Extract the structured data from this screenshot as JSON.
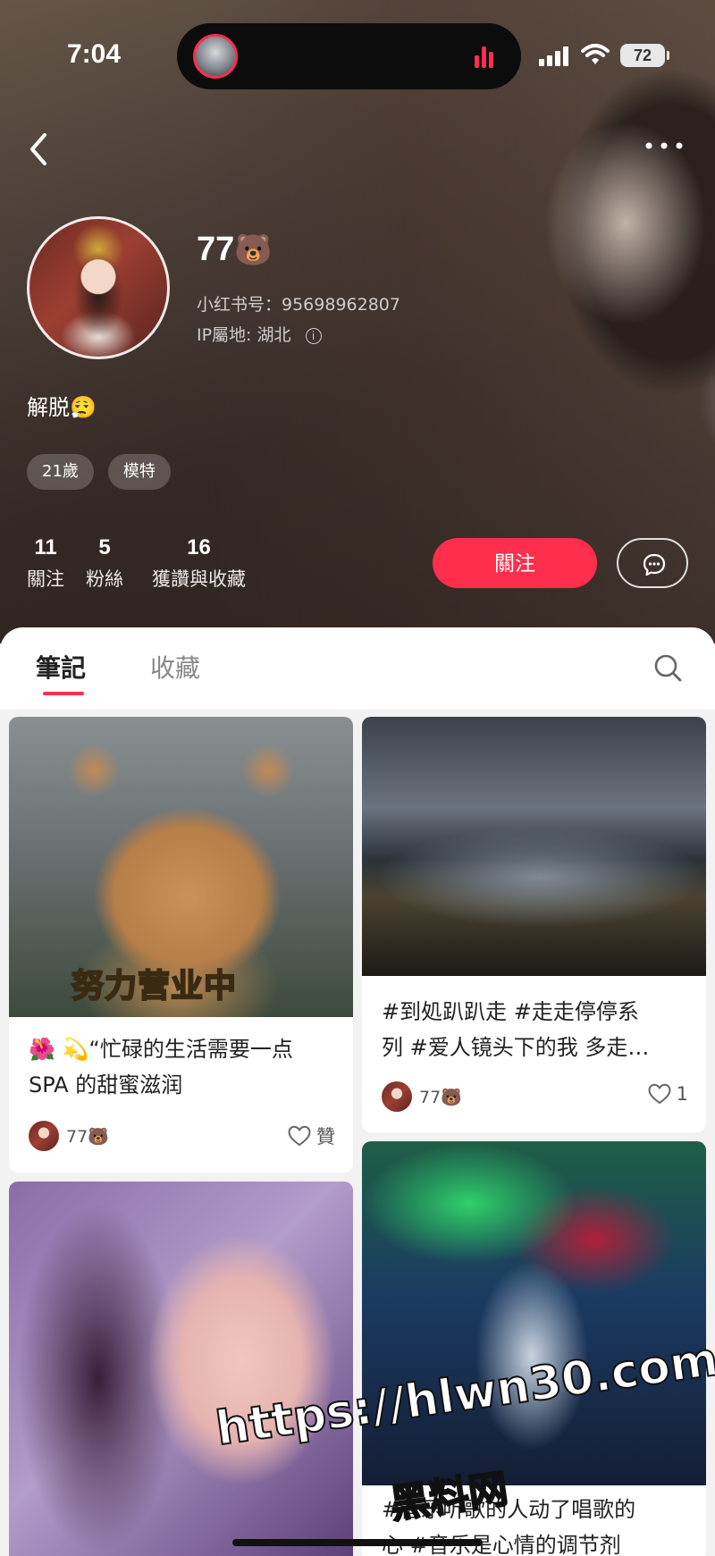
{
  "status_bar": {
    "time": "7:04",
    "battery": "72"
  },
  "profile": {
    "username": "77",
    "username_emoji": "🐻",
    "account_id": "小红书号：95698962807",
    "ip_location": "IP屬地: 湖北",
    "bio": "解脱😮‍💨",
    "tags": [
      "21歲",
      "模特"
    ],
    "stats": [
      {
        "value": "11",
        "label": "關注"
      },
      {
        "value": "5",
        "label": "粉絲"
      },
      {
        "value": "16",
        "label": "獲讚與收藏"
      }
    ],
    "follow_label": "關注"
  },
  "tabs": {
    "notes": "筆記",
    "collect": "收藏"
  },
  "notes": [
    {
      "title_line1": "🌺 💫“忙碌的生活需要一点",
      "title_line2": "SPA 的甜蜜滋润",
      "image_text": "努力营业中",
      "author": "77🐻",
      "likes": "贊"
    },
    {
      "title_line1": "#到処趴趴走 #走走停停系",
      "title_line2": "列 #爱人镜头下的我 多走…",
      "author": "77🐻",
      "likes": "1"
    },
    {
      "title_line1": "#音乐听歌的人动了唱歌的",
      "title_line2": "心 #音乐是心情的调节剂"
    }
  ],
  "watermark": {
    "url": "https://hlwn30.com",
    "name": "黑料网"
  },
  "colors": {
    "accent": "#ff2e4d"
  },
  "icons": [
    "back-icon",
    "more-icon",
    "info-icon",
    "message-icon",
    "search-icon",
    "heart-icon"
  ]
}
